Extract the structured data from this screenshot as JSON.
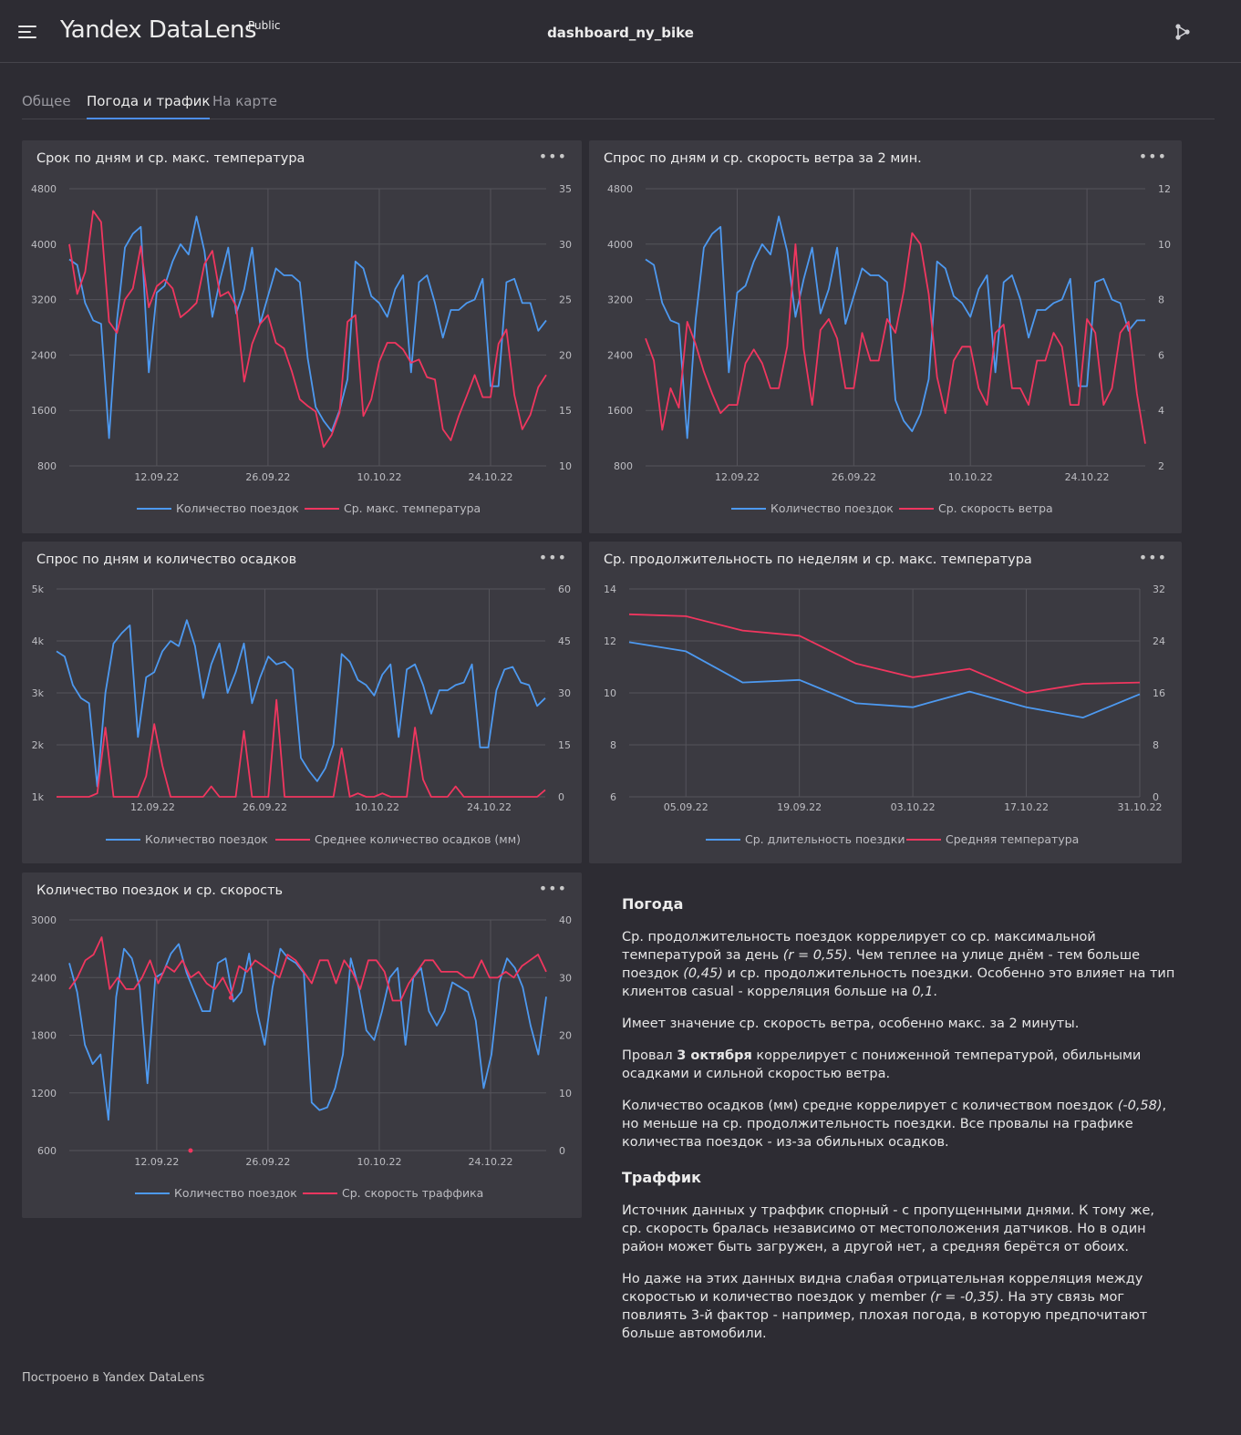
{
  "header": {
    "logo": "Yandex DataLens",
    "logo_badge": "Public",
    "dashboard_title": "dashboard_ny_bike"
  },
  "tabs": [
    {
      "label": "Общее"
    },
    {
      "label": "Погода и трафик",
      "active": true
    },
    {
      "label": "На карте"
    }
  ],
  "colors": {
    "blue": "#4d99f0",
    "red": "#f0365f",
    "grid": "#55545b",
    "text": "#bdbdc2"
  },
  "chart_data": [
    {
      "id": "c1",
      "type": "line",
      "title": "Срок по дням и ср. макс. температура",
      "x_start": "2022-09-01",
      "x_days": 60,
      "x_ticks": [
        "12.09.22",
        "26.09.22",
        "10.10.22",
        "24.10.22"
      ],
      "y_left": {
        "min": 800,
        "max": 4800,
        "ticks": [
          "4800",
          "4000",
          "3200",
          "2400",
          "1600",
          "800"
        ]
      },
      "y_right": {
        "min": 10,
        "max": 35,
        "ticks": [
          "35",
          "30",
          "25",
          "20",
          "15",
          "10"
        ]
      },
      "series": [
        {
          "name": "Количество поездок",
          "axis": "left",
          "color": "blue",
          "values": [
            3780,
            3700,
            3150,
            2900,
            2850,
            1200,
            2900,
            3950,
            4150,
            4250,
            2150,
            3300,
            3400,
            3750,
            4000,
            3850,
            4400,
            3900,
            2950,
            3500,
            3950,
            3000,
            3350,
            3950,
            2850,
            3250,
            3650,
            3550,
            3550,
            3450,
            2350,
            1650,
            1450,
            1300,
            1600,
            2050,
            3750,
            3650,
            3250,
            3150,
            2950,
            3350,
            3550,
            2150,
            3450,
            3550,
            3150,
            2650,
            3050,
            3050,
            3150,
            3200,
            3500,
            1950,
            1950,
            3450,
            3500,
            3150,
            3150,
            2750,
            2900
          ]
        },
        {
          "name": "Ср. макс. температура",
          "axis": "right",
          "color": "red",
          "values": [
            30,
            25.5,
            27.5,
            33,
            32,
            23,
            22,
            25,
            26,
            29.8,
            24.3,
            26.2,
            26.8,
            26,
            23.4,
            24,
            24.7,
            28.2,
            29.4,
            25.3,
            25.7,
            24.4,
            17.6,
            21,
            22.8,
            23.6,
            21.1,
            20.6,
            18.5,
            16,
            15.4,
            14.9,
            11.7,
            12.8,
            14.8,
            23,
            23.6,
            14.5,
            16,
            19.4,
            21.1,
            21.1,
            20.5,
            19.3,
            19.6,
            18,
            17.8,
            13.3,
            12.3,
            14.5,
            16.3,
            18.2,
            16.2,
            16.2,
            21,
            22.3,
            16.4,
            13.3,
            14.6,
            17.1,
            18.2
          ]
        }
      ]
    },
    {
      "id": "c2",
      "type": "line",
      "title": "Спрос по дням и ср. скорость ветра за 2 мин.",
      "x_start": "2022-09-01",
      "x_days": 60,
      "x_ticks": [
        "12.09.22",
        "26.09.22",
        "10.10.22",
        "24.10.22"
      ],
      "y_left": {
        "min": 800,
        "max": 4800,
        "ticks": [
          "4800",
          "4000",
          "3200",
          "2400",
          "1600",
          "800"
        ]
      },
      "y_right": {
        "min": 2,
        "max": 12,
        "ticks": [
          "12",
          "10",
          "8",
          "6",
          "4",
          "2"
        ]
      },
      "series": [
        {
          "name": "Количество поездок",
          "axis": "left",
          "color": "blue",
          "values": [
            3780,
            3700,
            3150,
            2900,
            2850,
            1200,
            2900,
            3950,
            4150,
            4250,
            2150,
            3300,
            3400,
            3750,
            4000,
            3850,
            4400,
            3900,
            2950,
            3500,
            3950,
            3000,
            3350,
            3950,
            2850,
            3250,
            3650,
            3550,
            3550,
            3450,
            1750,
            1450,
            1300,
            1550,
            2050,
            3750,
            3650,
            3250,
            3150,
            2950,
            3350,
            3550,
            2150,
            3450,
            3550,
            3200,
            2650,
            3050,
            3050,
            3150,
            3200,
            3500,
            1950,
            1950,
            3450,
            3500,
            3200,
            3150,
            2750,
            2900,
            2900
          ]
        },
        {
          "name": "Ср. скорость ветра",
          "axis": "right",
          "color": "red",
          "values": [
            6.6,
            5.8,
            3.3,
            4.8,
            4.1,
            7.2,
            6.4,
            5.4,
            4.6,
            3.9,
            4.2,
            4.2,
            5.7,
            6.2,
            5.7,
            4.8,
            4.8,
            6.3,
            10,
            6.2,
            4.2,
            6.9,
            7.3,
            6.6,
            4.8,
            4.8,
            6.8,
            5.8,
            5.8,
            7.3,
            6.8,
            8.3,
            10.4,
            10,
            8.2,
            5.2,
            3.9,
            5.8,
            6.3,
            6.3,
            4.8,
            4.2,
            6.8,
            7.1,
            4.8,
            4.8,
            4.2,
            5.8,
            5.8,
            6.8,
            6.3,
            4.2,
            4.2,
            7.3,
            6.8,
            4.2,
            4.8,
            6.8,
            7.2,
            4.6,
            2.8
          ]
        }
      ]
    },
    {
      "id": "c3",
      "type": "line",
      "title": "Спрос по дням и количество осадков",
      "x_start": "2022-08-31",
      "x_days": 61,
      "x_ticks": [
        "12.09.22",
        "26.09.22",
        "10.10.22",
        "24.10.22"
      ],
      "y_left": {
        "min": 1000,
        "max": 5000,
        "ticks": [
          "5k",
          "4k",
          "3k",
          "2k",
          "1k"
        ]
      },
      "y_right": {
        "min": 0,
        "max": 60,
        "ticks": [
          "60",
          "45",
          "30",
          "15",
          "0"
        ]
      },
      "series": [
        {
          "name": "Количество поездок",
          "axis": "left",
          "color": "blue",
          "values": [
            3800,
            3700,
            3150,
            2900,
            2800,
            1200,
            3000,
            3950,
            4150,
            4300,
            2150,
            3300,
            3400,
            3800,
            4000,
            3900,
            4400,
            3900,
            2900,
            3550,
            3950,
            3000,
            3400,
            3950,
            2800,
            3300,
            3700,
            3550,
            3600,
            3450,
            1750,
            1500,
            1300,
            1550,
            2000,
            3750,
            3600,
            3250,
            3150,
            2950,
            3350,
            3550,
            2150,
            3450,
            3550,
            3150,
            2600,
            3050,
            3050,
            3150,
            3200,
            3550,
            1950,
            1950,
            3050,
            3450,
            3500,
            3200,
            3150,
            2750,
            2900
          ]
        },
        {
          "name": "Среднее количество осадков (мм)",
          "axis": "right",
          "color": "red",
          "values": [
            0,
            0,
            0,
            0,
            0,
            1,
            20,
            0,
            0,
            0,
            0,
            6,
            21,
            9,
            0,
            0,
            0,
            0,
            0,
            3,
            0,
            0,
            0,
            19,
            0,
            0,
            0,
            28,
            0,
            0,
            0,
            0,
            0,
            0,
            0,
            14,
            0,
            1,
            0,
            0,
            1,
            0,
            0,
            0,
            20,
            5,
            0,
            0,
            0,
            3,
            0,
            0,
            0,
            0,
            0,
            0,
            0,
            0,
            0,
            0,
            2
          ]
        }
      ]
    },
    {
      "id": "c4",
      "type": "line",
      "title": "Ср. продолжительность по неделям и ср. макс. температура",
      "x_start": "2022-08-29",
      "x_days": 63,
      "x_ticks": [
        "05.09.22",
        "19.09.22",
        "03.10.22",
        "17.10.22",
        "31.10.22"
      ],
      "y_left": {
        "min": 6,
        "max": 14,
        "ticks": [
          "14",
          "12",
          "10",
          "8",
          "6"
        ]
      },
      "y_right": {
        "min": 0,
        "max": 32,
        "ticks": [
          "32",
          "24",
          "16",
          "8",
          "0"
        ]
      },
      "series": [
        {
          "name": "Ср. длительность поездки",
          "axis": "left",
          "color": "blue",
          "values": [
            11.95,
            11.6,
            10.4,
            10.5,
            9.6,
            9.45,
            10.05,
            9.45,
            9.05,
            9.95
          ]
        },
        {
          "name": "Средняя температура",
          "axis": "right",
          "color": "red",
          "values": [
            28.1,
            27.8,
            25.6,
            24.8,
            20.5,
            18.4,
            19.7,
            16,
            17.4,
            17.6
          ]
        }
      ]
    },
    {
      "id": "c5",
      "type": "line",
      "title": "Количество поездок и ср. скорость",
      "x_start": "2022-09-01",
      "x_days": 60,
      "x_ticks": [
        "12.09.22",
        "26.09.22",
        "10.10.22",
        "24.10.22"
      ],
      "y_left": {
        "min": 600,
        "max": 3000,
        "ticks": [
          "3000",
          "2400",
          "1800",
          "1200",
          "600"
        ]
      },
      "y_right": {
        "min": 0,
        "max": 40,
        "ticks": [
          "40",
          "30",
          "20",
          "10",
          "0"
        ]
      },
      "series": [
        {
          "name": "Количество поездок",
          "axis": "left",
          "color": "blue",
          "values": [
            2550,
            2250,
            1700,
            1500,
            1600,
            920,
            2200,
            2700,
            2600,
            2300,
            1300,
            2400,
            2450,
            2650,
            2750,
            2450,
            2250,
            2050,
            2050,
            2550,
            2600,
            2150,
            2250,
            2650,
            2050,
            1700,
            2300,
            2700,
            2600,
            2550,
            2450,
            1100,
            1020,
            1050,
            1250,
            1600,
            2600,
            2300,
            1850,
            1750,
            2050,
            2400,
            2500,
            1700,
            2400,
            2500,
            2050,
            1900,
            2050,
            2350,
            2300,
            2250,
            1950,
            1250,
            1600,
            2350,
            2600,
            2500,
            2300,
            1900,
            1600,
            2200
          ]
        },
        {
          "name": "Ср. скорость траффика",
          "axis": "right",
          "color": "red",
          "values": [
            28,
            30,
            33,
            34,
            37,
            28,
            30,
            28,
            28,
            30,
            33,
            29,
            32,
            31,
            33,
            30,
            31,
            29,
            28,
            30,
            27,
            32,
            31,
            33,
            32,
            31,
            30,
            34,
            33,
            31,
            29,
            33,
            33,
            29,
            33,
            31,
            28,
            33,
            33,
            31,
            26,
            26,
            29,
            31,
            33,
            33,
            31,
            31,
            31,
            30,
            30,
            33,
            30,
            30,
            31,
            30,
            32,
            33,
            34,
            31
          ]
        }
      ],
      "stray_points": [
        {
          "series": 1,
          "index": 20,
          "value": 26.5
        },
        {
          "series": 1,
          "index": 15,
          "value": 0
        }
      ]
    }
  ],
  "notes": {
    "h1": "Погода",
    "p1_a": "Ср. продолжительность поездок коррелирует со ср. максимальной температурой за день ",
    "p1_b": "(r = 0,55)",
    "p1_c": ". Чем теплее на улице днём - тем больше поездок ",
    "p1_d": "(0,45)",
    "p1_e": " и ср. продолжительность поездки. Особенно это влияет на тип клиентов casual - корреляция больше на ",
    "p1_f": "0,1",
    "p1_g": ".",
    "p2": "Имеет значение ср. скорость ветра, особенно макс. за 2 минуты.",
    "p3_a": "Провал ",
    "p3_b": "3 октября",
    "p3_c": " коррелирует с пониженной температурой, обильными осадками и сильной скоростью ветра.",
    "p4_a": "Количество осадков (мм) средне коррелирует с количеством поездок ",
    "p4_b": "(-0,58)",
    "p4_c": ", но меньше на ср. продолжительность поездки. Все провалы на графике количества поездок - из-за обильных осадков.",
    "h2": "Траффик",
    "p5": "Источник данных у траффик спорный - с пропущенными днями. К тому же, ср. скорость бралась независимо от местоположения датчиков. Но в один район может быть загружен, а другой нет, а средняя берётся от обоих.",
    "p6_a": "Но даже на этих данных видна слабая отрицательная корреляция между скоростью и количество поездок у member ",
    "p6_b": "(r = -0,35)",
    "p6_c": ". На эту связь мог повлиять 3-й фактор - например, плохая погода, в которую предпочитают больше автомобили."
  },
  "footer": "Построено в Yandex DataLens"
}
